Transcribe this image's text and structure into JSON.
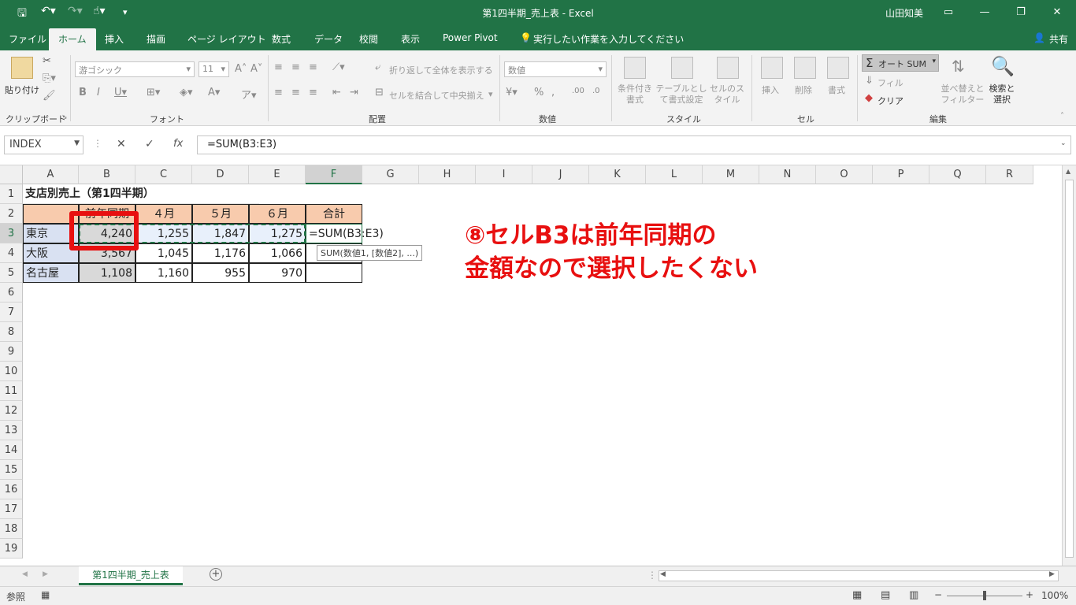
{
  "window": {
    "title": "第1四半期_売上表 - Excel",
    "user": "山田知美"
  },
  "tabs": [
    "ファイル",
    "ホーム",
    "挿入",
    "描画",
    "ページ レイアウト",
    "数式",
    "データ",
    "校閲",
    "表示",
    "Power Pivot"
  ],
  "tell_me": "実行したい作業を入力してください",
  "share": "共有",
  "ribbon": {
    "clipboard": {
      "paste": "貼り付け",
      "label": "クリップボード"
    },
    "font": {
      "name": "游ゴシック",
      "size": "11",
      "label": "フォント"
    },
    "alignment": {
      "wrap": "折り返して全体を表示する",
      "merge": "セルを結合して中央揃え",
      "label": "配置"
    },
    "number": {
      "format": "数値",
      "label": "数値"
    },
    "styles": {
      "conditional": "条件付き書式",
      "as_table": "テーブルとして書式設定",
      "cell_styles": "セルのスタイル",
      "label": "スタイル"
    },
    "cells": {
      "insert": "挿入",
      "delete": "削除",
      "format": "書式",
      "label": "セル"
    },
    "editing": {
      "autosum": "オート SUM",
      "fill": "フィル",
      "clear": "クリア",
      "sort": "並べ替えとフィルター",
      "find": "検索と選択",
      "label": "編集"
    }
  },
  "formula_bar": {
    "name_box": "INDEX",
    "formula": "=SUM(B3:E3)"
  },
  "columns": [
    "A",
    "B",
    "C",
    "D",
    "E",
    "F",
    "G",
    "H",
    "I",
    "J",
    "K",
    "L",
    "M",
    "N",
    "O",
    "P",
    "Q",
    "R"
  ],
  "rows": [
    "1",
    "2",
    "3",
    "4",
    "5",
    "6",
    "7",
    "8",
    "9",
    "10",
    "11",
    "12",
    "13",
    "14",
    "15",
    "16",
    "17",
    "18",
    "19"
  ],
  "sheet": {
    "title": "支店別売上（第1四半期）",
    "headers": [
      "",
      "前年同期",
      "４月",
      "５月",
      "６月",
      "合計"
    ],
    "data": [
      {
        "branch": "東京",
        "prev": "4,240",
        "m4": "1,255",
        "m5": "1,847",
        "m6": "1,275",
        "total": "=SUM(B3:E3)"
      },
      {
        "branch": "大阪",
        "prev": "3,567",
        "m4": "1,045",
        "m5": "1,176",
        "m6": "1,066",
        "total": ""
      },
      {
        "branch": "名古屋",
        "prev": "1,108",
        "m4": "1,160",
        "m5": "955",
        "m6": "970",
        "total": ""
      }
    ],
    "tooltip": "SUM(数値1, [数値2], ...)"
  },
  "sheet_tab": "第1四半期_売上表",
  "status": {
    "mode": "参照",
    "zoom": "100%"
  },
  "annotation": {
    "line1": "⑧セルB3は前年同期の",
    "line2": "金額なので選択したくない"
  },
  "colors": {
    "accent": "#217346",
    "callout": "#e81010"
  }
}
